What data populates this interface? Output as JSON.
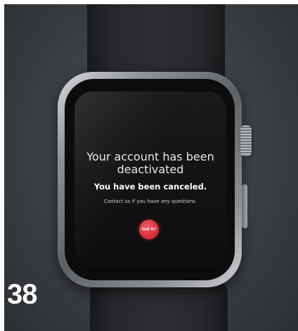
{
  "watch_screen": {
    "title": "Your account has been deactivated",
    "subtitle": "You have been canceled.",
    "message": "Contact us if you have any questions.",
    "button_label": "Got it?"
  },
  "badge_number": "38",
  "colors": {
    "button_accent": "#d8323e",
    "screen_background": "#121214",
    "backdrop": "#3b3e42"
  }
}
